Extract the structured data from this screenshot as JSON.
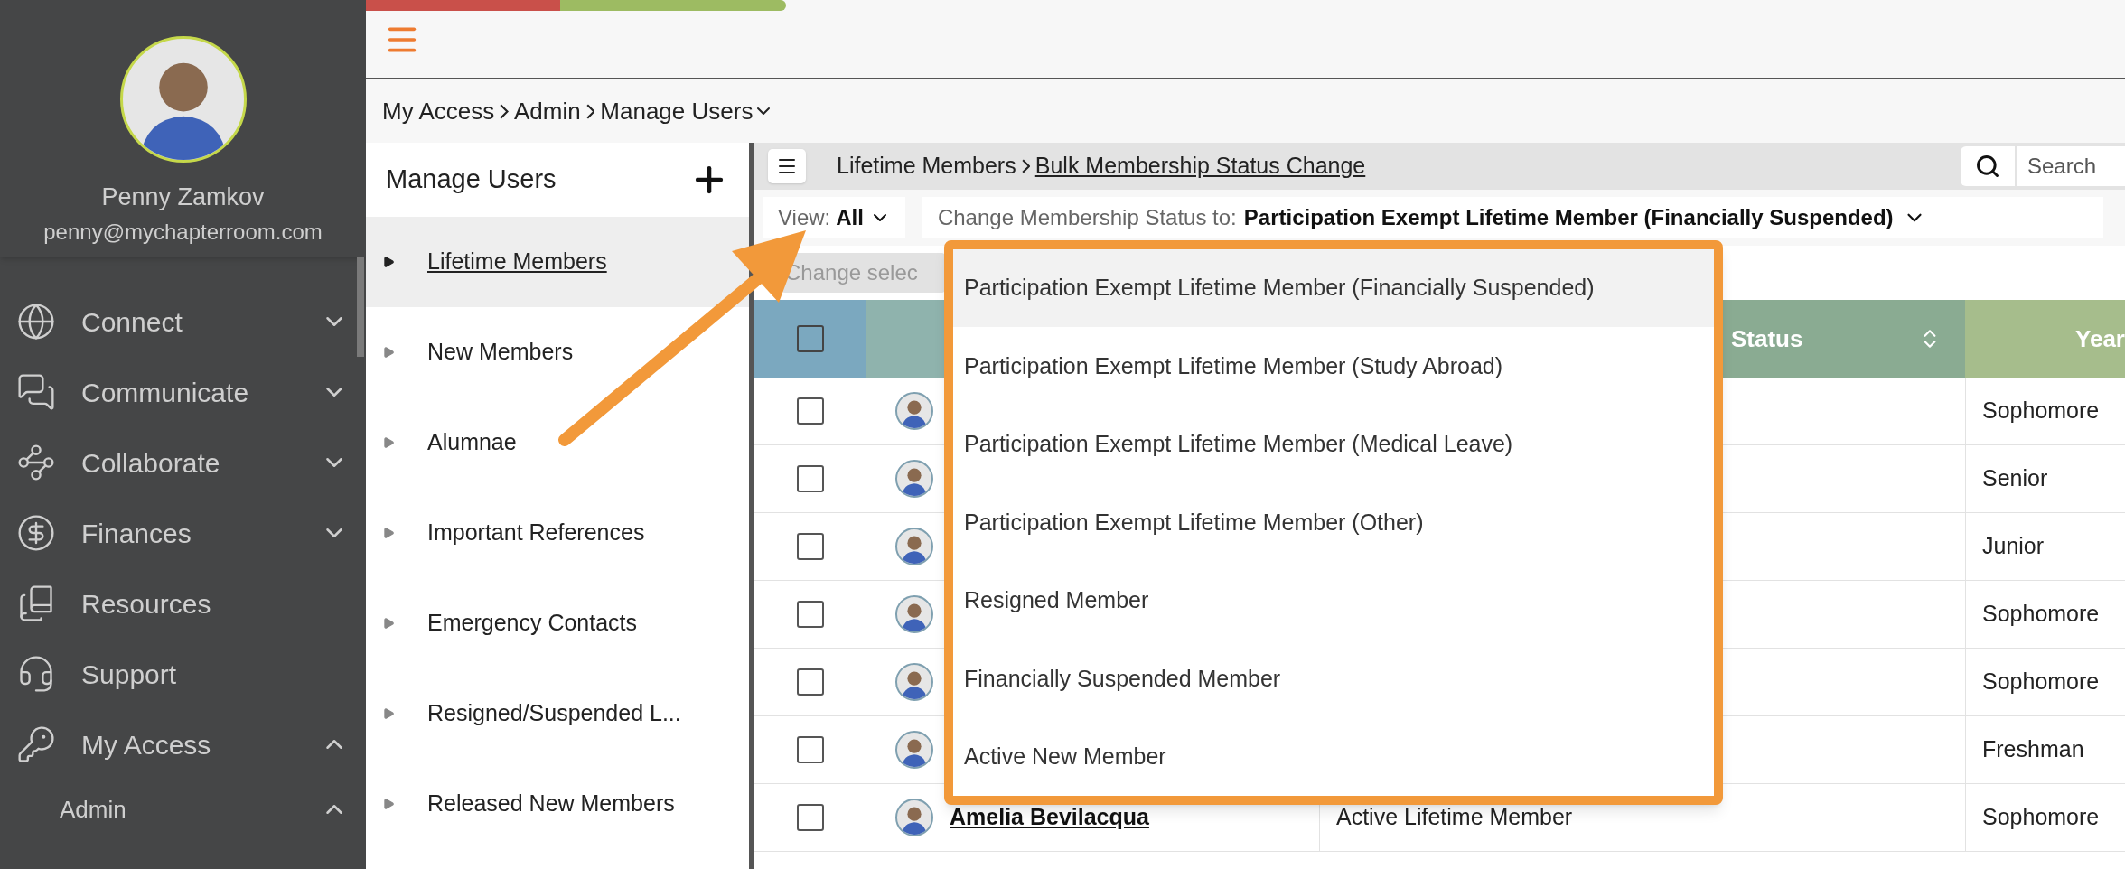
{
  "sidebar": {
    "user": {
      "name": "Penny Zamkov",
      "email": "penny@mychapterroom.com"
    },
    "nav": [
      {
        "label": "Connect",
        "expanded": false
      },
      {
        "label": "Communicate",
        "expanded": false
      },
      {
        "label": "Collaborate",
        "expanded": false
      },
      {
        "label": "Finances",
        "expanded": false
      },
      {
        "label": "Resources"
      },
      {
        "label": "Support"
      },
      {
        "label": "My Access",
        "expanded": true
      }
    ],
    "subnav": [
      {
        "label": "Admin",
        "expanded": true
      }
    ]
  },
  "breadcrumb": [
    "My Access",
    "Admin",
    "Manage Users"
  ],
  "left_panel": {
    "title": "Manage Users",
    "items": [
      {
        "label": "Lifetime Members",
        "selected": true
      },
      {
        "label": "New Members",
        "selected": false
      },
      {
        "label": "Alumnae",
        "selected": false
      },
      {
        "label": "Important References",
        "selected": false
      },
      {
        "label": "Emergency Contacts",
        "selected": false
      },
      {
        "label": "Resigned/Suspended L...",
        "selected": false
      },
      {
        "label": "Released New Members",
        "selected": false
      }
    ]
  },
  "toolbar": {
    "crumbs": [
      "Lifetime Members",
      "Bulk Membership Status Change"
    ],
    "search": {
      "placeholder": "Search"
    }
  },
  "view": {
    "label": "View:",
    "value": "All"
  },
  "status_select": {
    "label": "Change Membership Status to:",
    "value": "Participation Exempt Lifetime Member (Financially Suspended)",
    "expanded": true,
    "options": [
      {
        "label": "Participation Exempt Lifetime Member (Financially Suspended)",
        "selected": true
      },
      {
        "label": "Participation Exempt Lifetime Member (Study Abroad)",
        "selected": false
      },
      {
        "label": "Participation Exempt Lifetime Member (Medical Leave)",
        "selected": false
      },
      {
        "label": "Participation Exempt Lifetime Member (Other)",
        "selected": false
      },
      {
        "label": "Resigned Member",
        "selected": false
      },
      {
        "label": "Financially Suspended Member",
        "selected": false
      },
      {
        "label": "Active New Member",
        "selected": false
      }
    ]
  },
  "change_button": {
    "label": "Change selec",
    "disabled": true
  },
  "table": {
    "header_checked": false,
    "columns": [
      {
        "label": "Status",
        "sortable": true
      },
      {
        "label": "Year"
      }
    ],
    "rows": [
      {
        "checked": false,
        "year": "Sophomore"
      },
      {
        "checked": false,
        "year": "Senior"
      },
      {
        "checked": false,
        "year": "Junior"
      },
      {
        "checked": false,
        "year": "Sophomore"
      },
      {
        "checked": false,
        "year": "Sophomore"
      },
      {
        "checked": false,
        "year": "Freshman"
      },
      {
        "checked": false,
        "name": "Amelia Bevilacqua",
        "status": "Active Lifetime Member",
        "year": "Sophomore"
      }
    ]
  }
}
